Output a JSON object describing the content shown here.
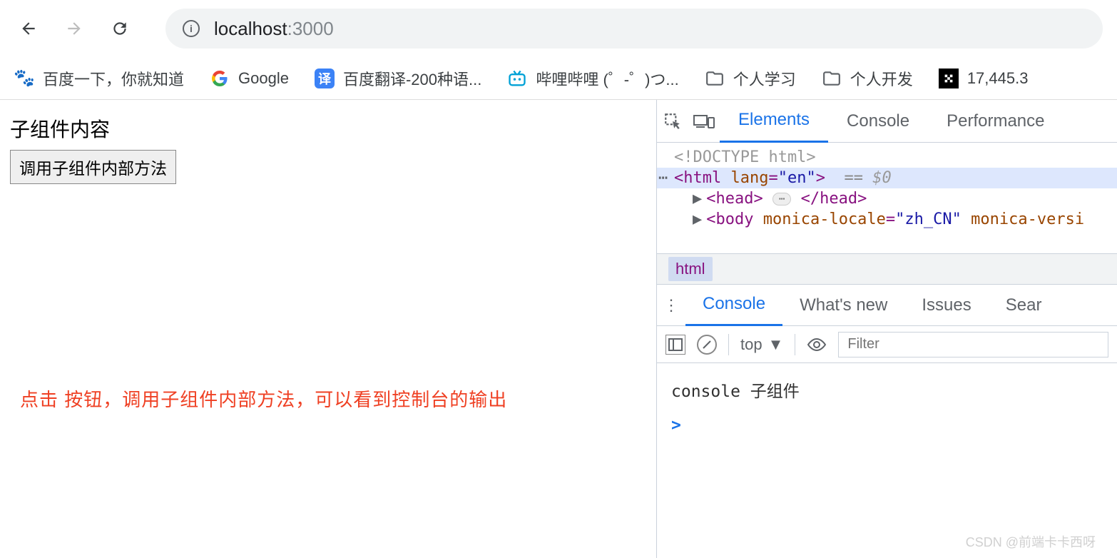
{
  "browser": {
    "url_host": "localhost",
    "url_port": ":3000"
  },
  "bookmarks": [
    {
      "label": "百度一下，你就知道",
      "icon": "baidu"
    },
    {
      "label": "Google",
      "icon": "google"
    },
    {
      "label": "百度翻译-200种语...",
      "icon": "translate"
    },
    {
      "label": "哔哩哔哩 (゜-゜)つ...",
      "icon": "bilibili"
    },
    {
      "label": "个人学习",
      "icon": "folder"
    },
    {
      "label": "个人开发",
      "icon": "folder"
    },
    {
      "label": "17,445.3",
      "icon": "ext"
    }
  ],
  "page": {
    "title": "子组件内容",
    "button_label": "调用子组件内部方法",
    "annotation": "点击 按钮，调用子组件内部方法，可以看到控制台的输出"
  },
  "devtools": {
    "tabs": {
      "elements": "Elements",
      "console": "Console",
      "performance": "Performance"
    },
    "elements": {
      "doctype": "<!DOCTYPE html>",
      "html_open": "<html lang=\"en\">",
      "eq": "==",
      "dollar": "$0",
      "head_open": "<head>",
      "head_close": "</head>",
      "body_open_attr1_name": "monica-locale",
      "body_open_attr1_val": "\"zh_CN\"",
      "body_open_attr2_name": "monica-versi"
    },
    "breadcrumb": "html",
    "drawer_tabs": {
      "console": "Console",
      "whatsnew": "What's new",
      "issues": "Issues",
      "search": "Sear"
    },
    "console_toolbar": {
      "context": "top",
      "filter_placeholder": "Filter"
    },
    "console_output": "console 子组件"
  },
  "watermark": "CSDN @前端卡卡西呀"
}
